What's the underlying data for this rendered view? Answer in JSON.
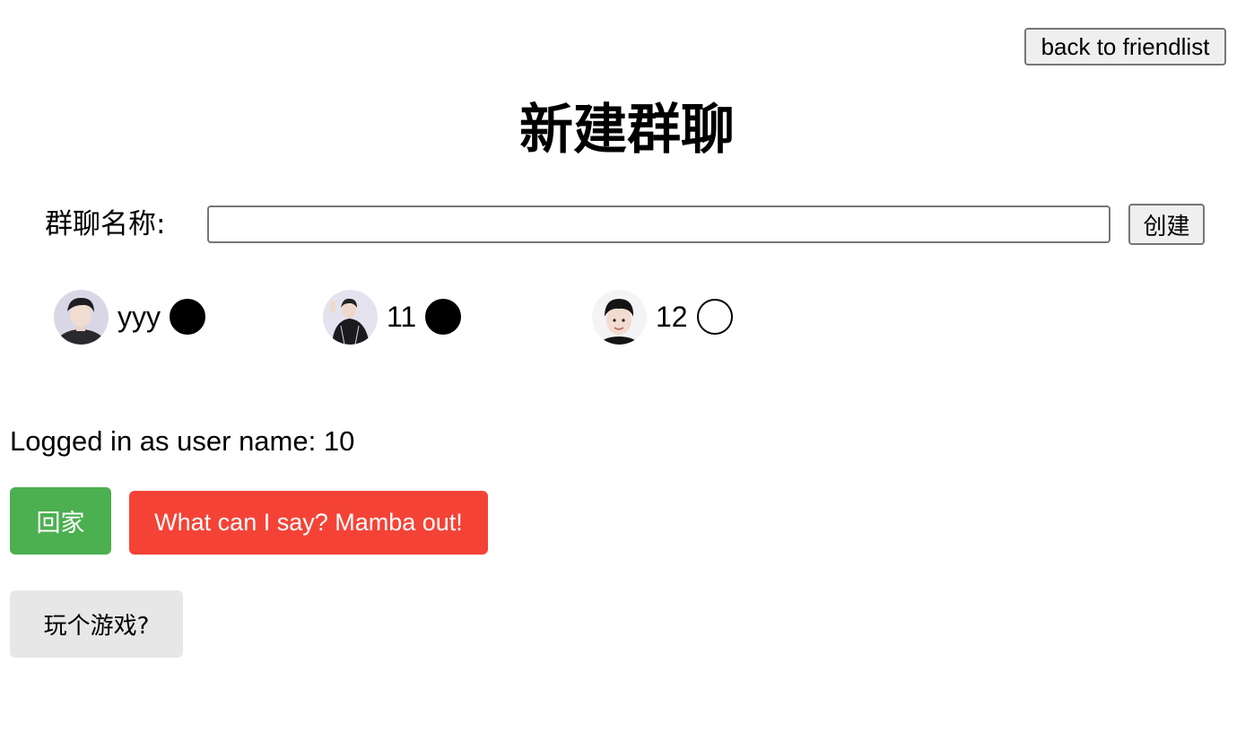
{
  "header": {
    "back_label": "back to friendlist"
  },
  "page_title": "新建群聊",
  "group_form": {
    "name_label": "群聊名称:",
    "name_value": "",
    "name_placeholder": "",
    "create_label": "创建"
  },
  "friends": [
    {
      "name": "yyy",
      "selected": true
    },
    {
      "name": "11",
      "selected": true
    },
    {
      "name": "12",
      "selected": false
    }
  ],
  "status": {
    "logged_in_text": "Logged in as user name: 10"
  },
  "actions": {
    "home_label": "回家",
    "mamba_label": "What can I say? Mamba out!",
    "game_label": "玩个游戏?"
  },
  "colors": {
    "home_bg": "#4caf50",
    "mamba_bg": "#f44336",
    "game_bg": "#e7e7e7",
    "radio_selected": "#000000"
  },
  "icons": {
    "avatar_1": "avatar-photo",
    "avatar_2": "avatar-photo",
    "avatar_3": "avatar-photo"
  }
}
